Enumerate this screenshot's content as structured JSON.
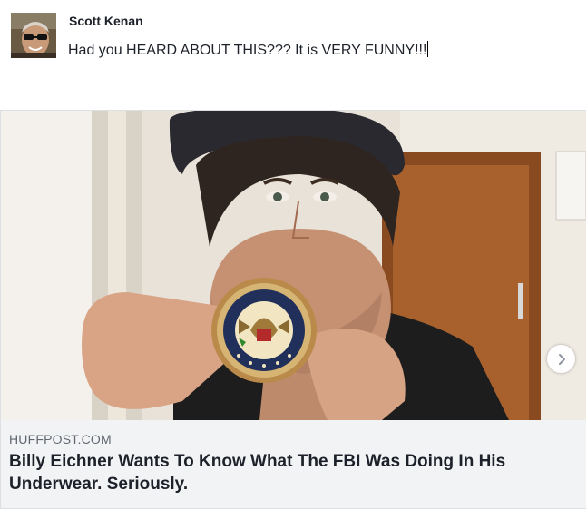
{
  "post": {
    "author_name": "Scott Kenan",
    "text": "Had you HEARD ABOUT THIS??? It is VERY FUNNY!!!"
  },
  "link_preview": {
    "domain": "HUFFPOST.COM",
    "headline": "Billy Eichner Wants To Know What The FBI Was Doing In His Underwear. Seriously.",
    "image": "photo of a man in a black cap holding up an FBI badge coaster to his mouth",
    "next_icon": "chevron-right-icon"
  },
  "badge": {
    "top_text": "FEDERAL BUREAU OF INVESTIGATION",
    "bottom_text": "DEPARTMENT OF JUSTICE"
  },
  "colors": {
    "text_primary": "#1d2129",
    "text_secondary": "#606770",
    "footer_bg": "#f2f3f5",
    "border": "#dddfe2"
  }
}
